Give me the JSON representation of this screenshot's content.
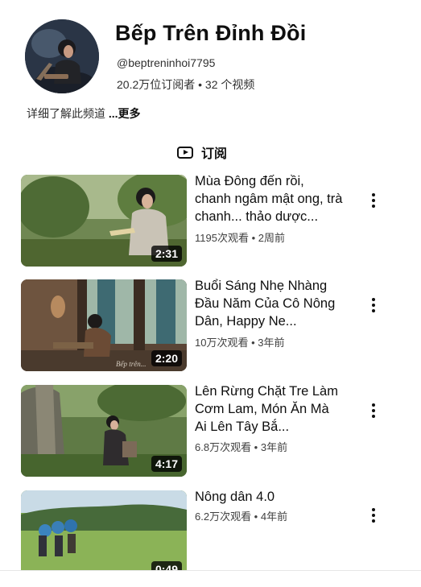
{
  "channel": {
    "name": "Bếp Trên Đỉnh Đồi",
    "handle": "@beptreninhoi7795",
    "stats": "20.2万位订阅者 • 32 个视频",
    "about_text": "详细了解此频道 ",
    "about_more": "...更多",
    "avatar_icon": "channel-avatar"
  },
  "subscribe": {
    "icon": "subscriptions-icon",
    "label": "订阅"
  },
  "videos": [
    {
      "title": "Mùa Đông đến rồi, chanh ngâm mật ong, trà chanh... thảo dược...",
      "meta": "1195次观看 • 2周前",
      "duration": "2:31"
    },
    {
      "title": "Buổi Sáng Nhẹ Nhàng Đầu Năm Của Cô Nông Dân, Happy Ne...",
      "meta": "10万次观看 • 3年前",
      "duration": "2:20"
    },
    {
      "title": "Lên Rừng Chặt Tre Làm Cơm Lam, Món Ăn Mà Ai Lên Tây Bắ...",
      "meta": "6.8万次观看 • 3年前",
      "duration": "4:17"
    },
    {
      "title": "Nông dân 4.0",
      "meta": "6.2万次观看 • 4年前",
      "duration": "0:49"
    }
  ]
}
